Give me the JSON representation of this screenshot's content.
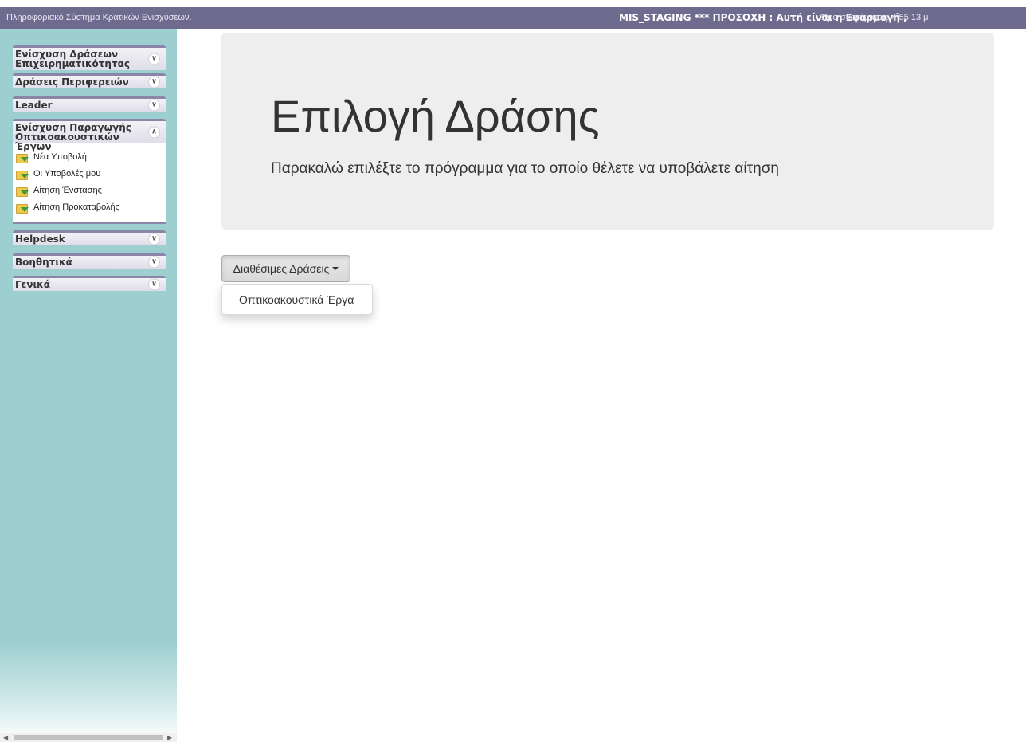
{
  "topbar": {
    "app_title": "Πληροφοριακό Σύστημα Κρατικών Ενισχύσεων.",
    "env_warning": "MIS_STAGING *** ΠΡΟΣΟΧΗ : Αυτή είναι η Εφαρμογή ,",
    "system_time": "Ώρα συστήματος: 4:55:13 μ"
  },
  "sidebar": {
    "sections": [
      {
        "label": "Ενίσχυση Δράσεων Επιχειρηματικότητας",
        "icon": "chevron-double-down-icon"
      },
      {
        "label": "Δράσεις Περιφερειών",
        "icon": "chevron-double-down-icon"
      },
      {
        "label": "Leader",
        "icon": "chevron-double-down-icon"
      },
      {
        "label": "Ενίσχυση Παραγωγής Οπτικοακουστικών Έργων",
        "icon": "chevron-double-up-icon",
        "items": [
          {
            "label": "Νέα Υποβολή",
            "icon": "folder-arrow-icon"
          },
          {
            "label": "Οι Υποβολές μου",
            "icon": "folder-arrow-icon"
          },
          {
            "label": "Αίτηση Ένστασης",
            "icon": "folder-arrow-icon"
          },
          {
            "label": "Αίτηση Προκαταβολής",
            "icon": "folder-arrow-icon"
          }
        ]
      },
      {
        "label": "Helpdesk",
        "icon": "chevron-double-down-icon"
      },
      {
        "label": "Βοηθητικά",
        "icon": "chevron-double-down-icon"
      },
      {
        "label": "Γενικά",
        "icon": "chevron-double-down-icon"
      }
    ]
  },
  "main": {
    "title": "Επιλογή Δράσης",
    "subtitle": "Παρακαλώ επιλέξτε το πρόγραμμα για το οποίο θέλετε να υποβάλετε αίτηση",
    "dropdown": {
      "label": "Διαθέσιμες Δράσεις",
      "options": [
        "Οπτικοακουστικά Έργα"
      ]
    }
  },
  "colors": {
    "topbar": "#6f6b8f",
    "sidebar": "#9ecfd0",
    "jumbotron": "#eeeeee"
  }
}
